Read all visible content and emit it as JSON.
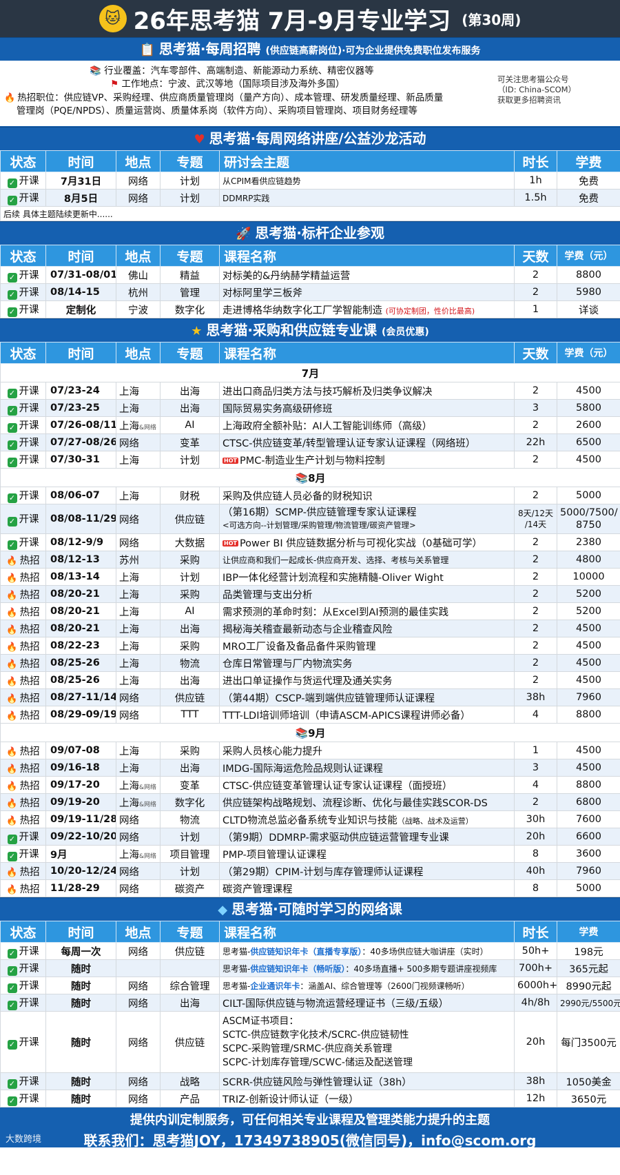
{
  "header": {
    "title": "26年思考猫 7月-9月专业学习",
    "week": "(第30周)"
  },
  "recruit": {
    "title": "思考猫·每周招聘",
    "title_small": "(供应链高薪岗位)",
    "title_tail": "·可为企业提供免费职位发布服务",
    "industry": "行业覆盖：汽车零部件、高端制造、新能源动力系统、精密仪器等",
    "location": "工作地点：宁波、武汉等地（国际项目涉及海外多国）",
    "jobs_1": "热招职位：供应链VP、采购经理、供应商质量管理岗（量产方向）、成本管理、研发质量经理、新品质量",
    "jobs_2": "管理岗（PQE/NPDS）、质量运营岗、质量体系岗（软件方向）、采购项目管理岗、项目财务经理等",
    "note_1": "可关注思考猫公众号",
    "note_2": "（ID: China-SCOM）",
    "note_3": "获取更多招聘资讯"
  },
  "seminar": {
    "title": "思考猫·每周网络讲座/公益沙龙活动",
    "headers": [
      "状态",
      "时间",
      "地点",
      "专题",
      "研讨会主题",
      "时长",
      "学费"
    ],
    "rows": [
      [
        "开课",
        "7月31日",
        "网络",
        "计划",
        "从CPIM看供应链趋势",
        "1h",
        "免费"
      ],
      [
        "开课",
        "8月5日",
        "网络",
        "计划",
        "DDMRP实践",
        "1.5h",
        "免费"
      ]
    ],
    "note": "后续 具体主题陆续更新中......"
  },
  "visit": {
    "title": "思考猫·标杆企业参观",
    "headers": [
      "状态",
      "时间",
      "地点",
      "专题",
      "课程名称",
      "天数",
      "学费（元）"
    ],
    "rows": [
      [
        "开课",
        "07/31-08/01",
        "佛山",
        "精益",
        "对标美的&丹纳赫学精益运营",
        "2",
        "8800"
      ],
      [
        "开课",
        "08/14-15",
        "杭州",
        "管理",
        "对标阿里学三板斧",
        "2",
        "5980"
      ],
      [
        "开课",
        "定制化",
        "宁波",
        "数字化",
        "走进博格华纳数字化工厂学智能制造",
        "1",
        "详谈"
      ]
    ],
    "visit_note": "(可协定制团，性价比最高)"
  },
  "courses": {
    "title": "思考猫·采购和供应链专业课",
    "title_small": "(会员优惠)",
    "headers": [
      "状态",
      "时间",
      "地点",
      "专题",
      "课程名称",
      "天数",
      "学费（元）"
    ],
    "net_tag": "&网络",
    "hot_tag": "HOT",
    "months": {
      "jul": "7月",
      "aug": "8月",
      "sep": "9月"
    },
    "jul": [
      [
        "开课",
        "07/23-24",
        "上海",
        "出海",
        "进出口商品归类方法与技巧解析及归类争议解决",
        "2",
        "4500"
      ],
      [
        "开课",
        "07/23-25",
        "上海",
        "出海",
        "国际贸易实务高级研修班",
        "3",
        "5800"
      ],
      [
        "开课",
        "07/26-08/11",
        "上海",
        "AI",
        "上海政府全额补贴：AI人工智能训练师（高级）",
        "2",
        "2600"
      ],
      [
        "开课",
        "07/27-08/26",
        "网络",
        "变革",
        "CTSC-供应链变革/转型管理认证专家认证课程（网络班）",
        "22h",
        "6500"
      ],
      [
        "开课",
        "07/30-31",
        "上海",
        "计划",
        "PMC-制造业生产计划与物料控制",
        "2",
        "4500"
      ]
    ],
    "aug": [
      [
        "开课",
        "08/06-07",
        "上海",
        "财税",
        "采购及供应链人员必备的财税知识",
        "2",
        "5000"
      ],
      [
        "开课",
        "08/12-9/9",
        "网络",
        "大数据",
        "Power BI 供应链数据分析与可视化实战（0基础可学）",
        "2",
        "2380"
      ],
      [
        "热招",
        "08/12-13",
        "苏州",
        "采购",
        "让供应商和我们一起成长-供应商开发、选择、考核与关系管理",
        "2",
        "4800"
      ],
      [
        "热招",
        "08/13-14",
        "上海",
        "计划",
        "IBP一体化经营计划流程和实施精髓-Oliver Wight",
        "2",
        "10000"
      ],
      [
        "热招",
        "08/20-21",
        "上海",
        "采购",
        "品类管理与支出分析",
        "2",
        "5200"
      ],
      [
        "热招",
        "08/20-21",
        "上海",
        "AI",
        "需求预测的革命时刻：从Excel到AI预测的最佳实践",
        "2",
        "5200"
      ],
      [
        "热招",
        "08/20-21",
        "上海",
        "出海",
        "揭秘海关稽查最新动态与企业稽查风险",
        "2",
        "4500"
      ],
      [
        "热招",
        "08/22-23",
        "上海",
        "采购",
        "MRO工厂设备及备品备件采购管理",
        "2",
        "4500"
      ],
      [
        "热招",
        "08/25-26",
        "上海",
        "物流",
        "仓库日常管理与厂内物流实务",
        "2",
        "4500"
      ],
      [
        "热招",
        "08/25-26",
        "上海",
        "出海",
        "进出口单证操作与货运代理及通关实务",
        "2",
        "4500"
      ],
      [
        "热招",
        "08/27-11/14",
        "网络",
        "供应链",
        "（第44期）CSCP-端到端供应链管理师认证课程",
        "38h",
        "7960"
      ],
      [
        "热招",
        "08/29-09/19",
        "网络",
        "TTT",
        "TTT-LDI培训师培训（申请ASCM-APICS课程讲师必备）",
        "4",
        "8800"
      ]
    ],
    "scmp": {
      "status": "开课",
      "time": "08/08-11/29",
      "place": "网络",
      "topic": "供应链",
      "name_1": "（第16期）SCMP-供应链管理专家认证课程",
      "name_2": "<可选方向--计划管理/采购管理/物流管理/碳资产管理>",
      "days_1": "8天/12天",
      "days_2": "/14天",
      "fee_1": "5000/7500/",
      "fee_2": "8750"
    },
    "sep": [
      [
        "热招",
        "09/07-08",
        "上海",
        "采购",
        "采购人员核心能力提升",
        "1",
        "4500"
      ],
      [
        "热招",
        "09/16-18",
        "上海",
        "出海",
        "IMDG-国际海运危险品规则认证课程",
        "3",
        "4500"
      ],
      [
        "热招",
        "09/17-20",
        "上海",
        "变革",
        "CTSC-供应链变革管理认证专家认证课程（面授班）",
        "4",
        "8800"
      ],
      [
        "热招",
        "09/19-20",
        "上海",
        "数字化",
        "供应链架构战略规划、流程诊断、优化与最佳实践SCOR-DS",
        "2",
        "6800"
      ],
      [
        "热招",
        "09/19-11/28",
        "网络",
        "物流",
        "CLTD物流总监必备系统专业知识与技能",
        "30h",
        "7600"
      ],
      [
        "开课",
        "09/22-10/20",
        "网络",
        "计划",
        "（第9期）DDMRP-需求驱动供应链运营管理专业课",
        "20h",
        "6600"
      ],
      [
        "开课",
        "9月",
        "上海",
        "项目管理",
        "PMP-项目管理认证课程",
        "8",
        "3600"
      ],
      [
        "热招",
        "10/20-12/24",
        "网络",
        "计划",
        "（第29期）CPIM-计划与库存管理师认证课程",
        "40h",
        "7960"
      ],
      [
        "热招",
        "11/28-29",
        "网络",
        "碳资产",
        "碳资产管理课程",
        "8",
        "5000"
      ]
    ],
    "cltd_note": "（战略、战术及运营）"
  },
  "online": {
    "title": "思考猫·可随时学习的网络课",
    "headers": [
      "状态",
      "时间",
      "地点",
      "专题",
      "课程名称",
      "时长",
      "学费"
    ],
    "r1": {
      "status": "开课",
      "time": "每周一次",
      "place": "网络",
      "topic": "供应链",
      "pre": "思考猫-",
      "blue": "供应链知识年卡（直播专享版）",
      "tail": "：40多场供应链大咖讲座（实时）",
      "dur": "50h+",
      "fee": "198元"
    },
    "r2": {
      "status": "开课",
      "time": "随时",
      "place": "",
      "topic": "",
      "pre": "思考猫-",
      "blue": "供应链知识年卡（畅听版）",
      "tail": "：40多场直播+ 500多期专题讲座视频库",
      "dur": "700h+",
      "fee": "365元起"
    },
    "r3": {
      "status": "开课",
      "time": "随时",
      "place": "网络",
      "topic": "综合管理",
      "pre": "思考猫-",
      "blue": "企业通识年卡",
      "tail": "：涵盖AI、综合管理等（2600门视频课畅听）",
      "dur": "6000h+",
      "fee": "8990元起"
    },
    "r4": {
      "status": "开课",
      "time": "随时",
      "place": "网络",
      "topic": "出海",
      "name": "CILT-国际供应链与物流运营经理证书（三级/五级）",
      "dur": "4h/8h",
      "fee": "2990元/5500元"
    },
    "r5": {
      "status": "开课",
      "time": "随时",
      "place": "网络",
      "topic": "供应链",
      "l1": "ASCM证书项目：",
      "l2": "SCTC-供应链数字化技术/SCRC-供应链韧性",
      "l3": "SCPC-采购管理/SRMC-供应商关系管理",
      "l4": "SCPC-计划库存管理/SCWC-储运及配送管理",
      "dur": "20h",
      "fee": "每门3500元"
    },
    "r6": {
      "status": "开课",
      "time": "随时",
      "place": "网络",
      "topic": "战略",
      "name": "SCRR-供应链风险与弹性管理认证（38h）",
      "dur": "38h",
      "fee": "1050美金"
    },
    "r7": {
      "status": "开课",
      "time": "随时",
      "place": "网络",
      "topic": "产品",
      "name": "TRIZ-创新设计师认证（一级）",
      "dur": "12h",
      "fee": "3650元"
    }
  },
  "footer": {
    "line1": "提供内训定制服务，可任何相关专业课程及管理类能力提升的主题",
    "line2": "联系我们：思考猫JOY，17349738905(微信同号)，info@scom.org",
    "watermark": "大数跨境"
  },
  "colors": {
    "navy": "#2a3644",
    "blue": "#1560b0",
    "th": "#2e96df",
    "check": "#25a244",
    "flame": "#f07a12",
    "red": "#d4171c"
  }
}
